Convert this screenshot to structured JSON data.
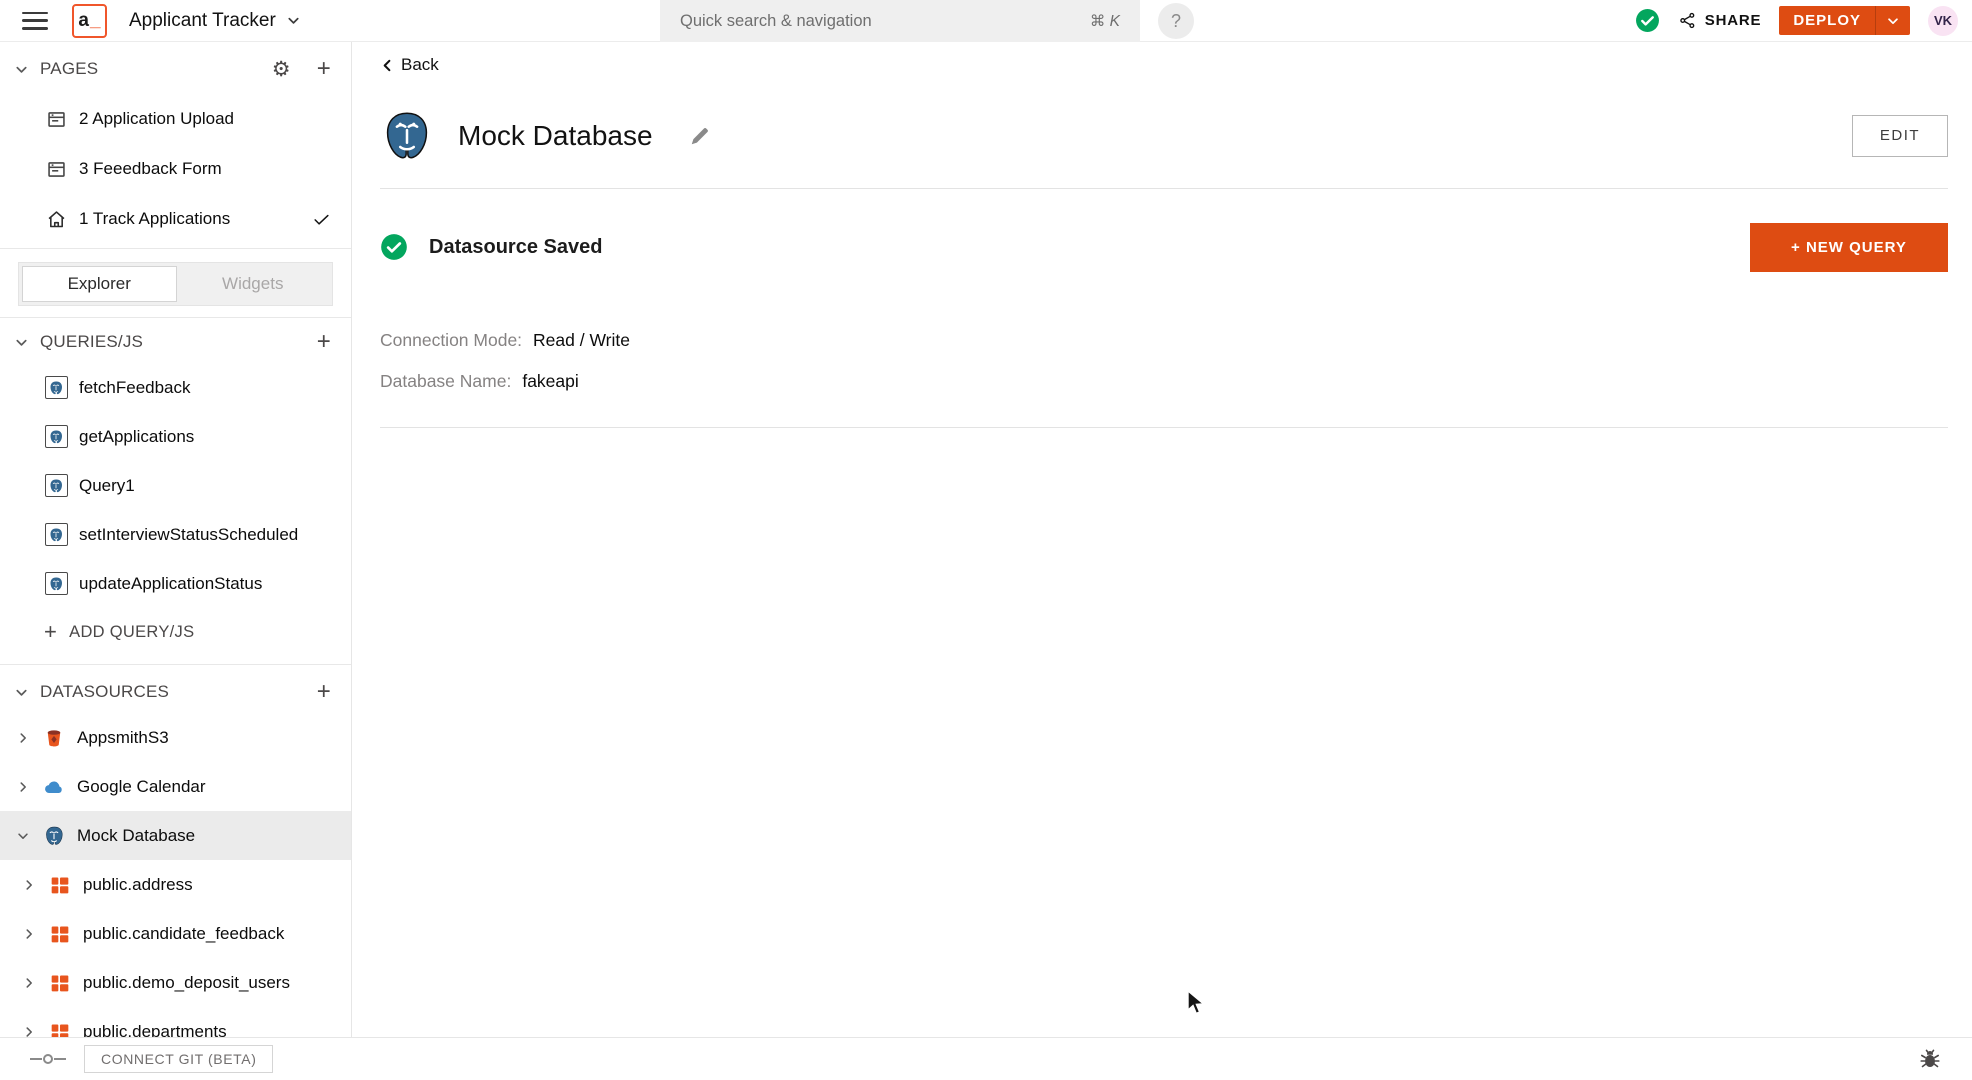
{
  "header": {
    "app_title": "Applicant Tracker",
    "search": {
      "placeholder": "Quick search & navigation",
      "shortcut": "⌘ K"
    },
    "help_label": "?",
    "share_label": "SHARE",
    "deploy_label": "DEPLOY",
    "avatar_initials": "VK"
  },
  "sidebar": {
    "pages": {
      "title": "PAGES",
      "items": [
        {
          "label": "2 Application Upload",
          "icon": "page-icon"
        },
        {
          "label": "3 Feeedback Form",
          "icon": "page-icon"
        },
        {
          "label": "1 Track Applications",
          "icon": "home-icon",
          "checked": true
        }
      ]
    },
    "tabs": {
      "explorer": "Explorer",
      "widgets": "Widgets",
      "active": "Explorer"
    },
    "queries": {
      "title": "QUERIES/JS",
      "items": [
        {
          "label": "fetchFeedback",
          "icon": "postgres-icon"
        },
        {
          "label": "getApplications",
          "icon": "postgres-icon"
        },
        {
          "label": "Query1",
          "icon": "postgres-icon"
        },
        {
          "label": "setInterviewStatusScheduled",
          "icon": "postgres-icon"
        },
        {
          "label": "updateApplicationStatus",
          "icon": "postgres-icon"
        }
      ],
      "add_label": "ADD QUERY/JS"
    },
    "datasources": {
      "title": "DATASOURCES",
      "items": [
        {
          "label": "AppsmithS3",
          "icon": "s3-icon",
          "expanded": false
        },
        {
          "label": "Google Calendar",
          "icon": "cloud-icon",
          "expanded": false
        },
        {
          "label": "Mock Database",
          "icon": "postgres-icon",
          "expanded": true,
          "selected": true
        },
        {
          "label": "public.address",
          "icon": "table-icon",
          "expanded": false
        },
        {
          "label": "public.candidate_feedback",
          "icon": "table-icon",
          "expanded": false
        },
        {
          "label": "public.demo_deposit_users",
          "icon": "table-icon",
          "expanded": false
        },
        {
          "label": "public.departments",
          "icon": "table-icon",
          "expanded": false
        }
      ]
    }
  },
  "main": {
    "back_label": "Back",
    "title": "Mock Database",
    "edit_button": "EDIT",
    "status_text": "Datasource Saved",
    "new_query_button": "+ NEW QUERY",
    "fields": [
      {
        "label": "Connection Mode:",
        "value": "Read / Write"
      },
      {
        "label": "Database Name:",
        "value": "fakeapi"
      }
    ]
  },
  "footer": {
    "connect_git_label": "CONNECT GIT (BETA)"
  },
  "colors": {
    "accent_orange": "#DE4C12",
    "success_green": "#03A65E",
    "postgres_blue": "#336791",
    "table_orange": "#E8551E",
    "s3_red": "#8C3123",
    "calendar_blue": "#3F8CCC",
    "avatar_pink": "#F9E3F3",
    "selected_row_gray": "#EBEBEB"
  }
}
